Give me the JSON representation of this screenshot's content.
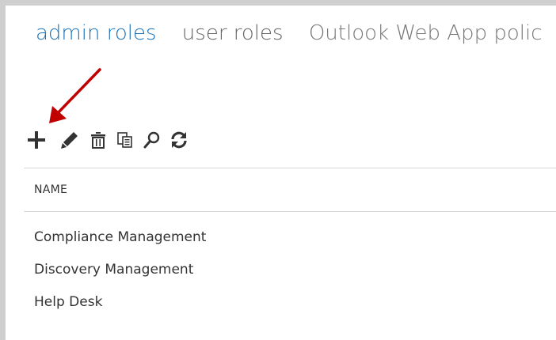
{
  "tabs": {
    "admin_roles": "admin roles",
    "user_roles": "user roles",
    "owa_policies": "Outlook Web App polic"
  },
  "colors": {
    "accent": "#1a73ba",
    "annotation_arrow": "#c00000",
    "frame_border": "#cfcfcf"
  },
  "toolbar": {
    "icons": [
      "add-icon",
      "edit-icon",
      "delete-icon",
      "copy-icon",
      "search-icon",
      "refresh-icon"
    ]
  },
  "table": {
    "column_header": "NAME",
    "rows": [
      "Compliance Management",
      "Discovery Management",
      "Help Desk"
    ]
  }
}
